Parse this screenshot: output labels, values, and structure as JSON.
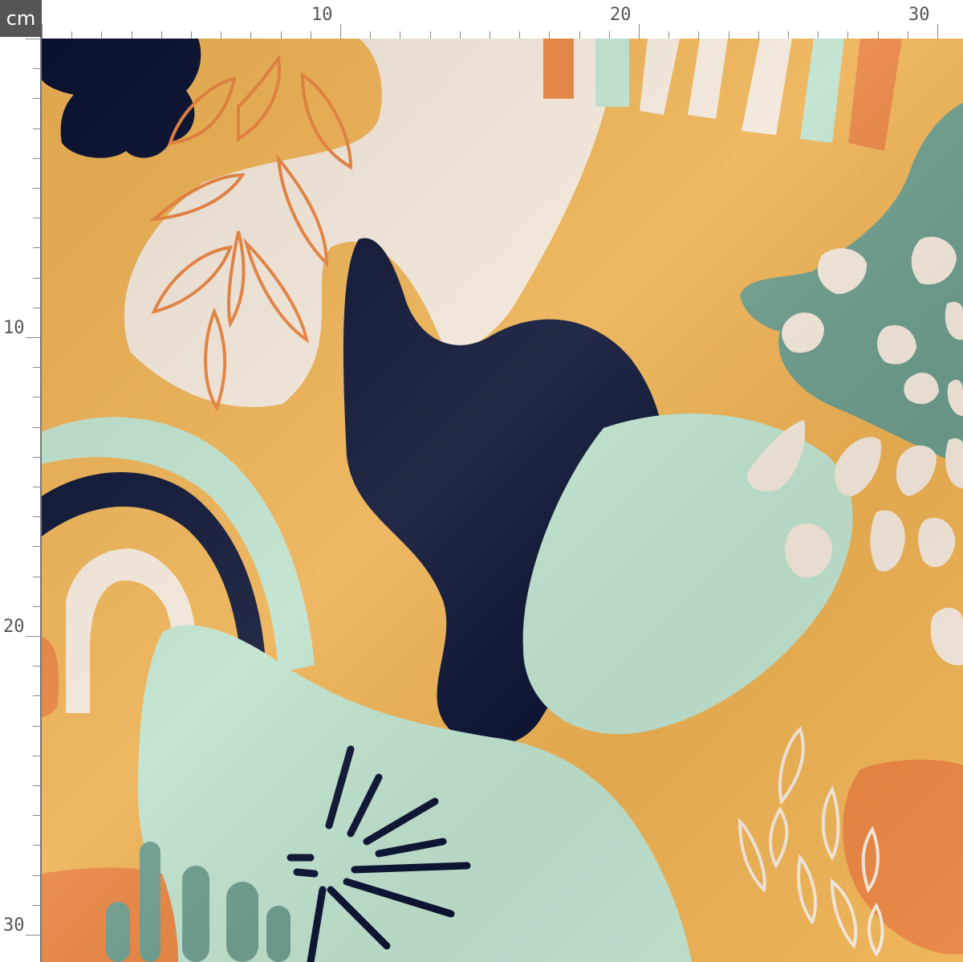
{
  "ruler": {
    "unit": "cm",
    "top_labels": [
      "10",
      "20",
      "30"
    ],
    "left_labels": [
      "10",
      "20",
      "30"
    ]
  },
  "palette": {
    "background": "#EDB153",
    "navy": "#0B1333",
    "cream": "#F3E7DA",
    "mint": "#BFE2CE",
    "sage": "#6C9C8C",
    "orange": "#E8833F"
  }
}
